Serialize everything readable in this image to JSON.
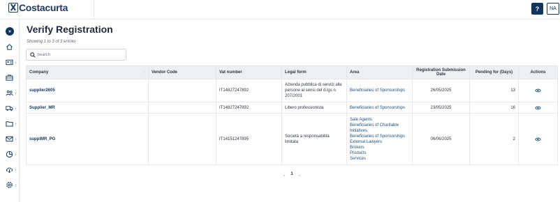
{
  "app": {
    "brand": "Costacurta"
  },
  "header": {
    "help_label": "?",
    "user_initials": "NA"
  },
  "sidebar": {
    "expand_label": "»",
    "items": [
      {
        "icon": "home-icon",
        "has_submenu": false
      },
      {
        "icon": "id-card-icon",
        "has_submenu": true
      },
      {
        "icon": "briefcase-icon",
        "has_submenu": false
      },
      {
        "icon": "users-icon",
        "has_submenu": true
      },
      {
        "icon": "truck-icon",
        "has_submenu": true
      },
      {
        "icon": "folder-icon",
        "has_submenu": true
      },
      {
        "icon": "mail-icon",
        "has_submenu": true
      },
      {
        "icon": "chart-icon",
        "has_submenu": true
      },
      {
        "icon": "cloud-download-icon",
        "has_submenu": true
      },
      {
        "icon": "gear-icon",
        "has_submenu": true
      }
    ]
  },
  "page": {
    "title": "Verify Registration",
    "entries_info": "Showing 1 to 3 of 3 entries",
    "search_placeholder": "Search"
  },
  "table": {
    "columns": [
      "Company",
      "Vendor Code",
      "Vat number",
      "Legal form",
      "Area",
      "Registration Submission Date",
      "Pending for (Days)",
      "Actions"
    ],
    "rows": [
      {
        "company": "supplier2605",
        "vendor_code": "",
        "vat": "IT14827247892",
        "legal_form": "Azienda pubblica di servizi alle persone ai sensi del d.lgs n. 207/2001",
        "areas": [
          "Beneficiaries of Sponsorships"
        ],
        "date": "26/05/2025",
        "pending": "13"
      },
      {
        "company": "Supplier_MR",
        "vendor_code": "",
        "vat": "IT14827247892",
        "legal_form": "Libero professionista",
        "areas": [
          "Beneficiaries of Sponsorships"
        ],
        "date": "23/05/2025",
        "pending": "16"
      },
      {
        "company": "supplMR_PG",
        "vendor_code": "",
        "vat": "IT14151247895",
        "legal_form": "Società a responsabilità limitata",
        "areas": [
          "Sale Agents",
          "Beneficiaries of Charitable Initiatives",
          "Beneficiaries of Sponsorships",
          "External Lawyers",
          "Brokers",
          "Products",
          "Services"
        ],
        "date": "06/06/2025",
        "pending": "2"
      }
    ]
  },
  "pagination": {
    "current_page": "1"
  }
}
